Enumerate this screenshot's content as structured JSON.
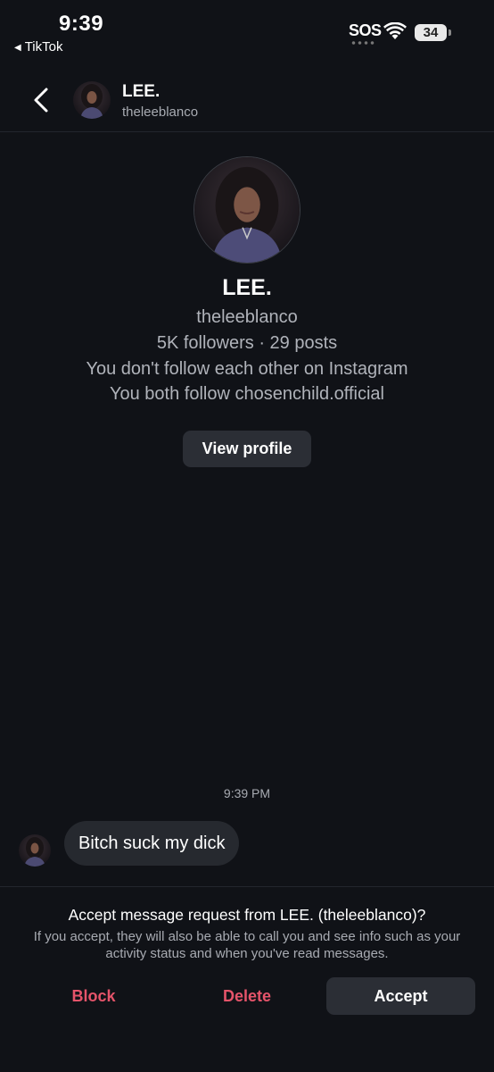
{
  "status_bar": {
    "time": "9:39",
    "back_app": "TikTok",
    "sos": "SOS",
    "battery": "34"
  },
  "header": {
    "name": "LEE.",
    "username": "theleeblanco"
  },
  "profile": {
    "name": "LEE.",
    "username": "theleeblanco",
    "stats": "5K followers · 29 posts",
    "follow_status": "You don't follow each other on Instagram",
    "mutual": "You both follow chosenchild.official",
    "view_profile_label": "View profile"
  },
  "messages": [
    {
      "time": "9:39 PM",
      "text": "Bitch suck my dick"
    }
  ],
  "request": {
    "title": "Accept message request from LEE. (theleeblanco)?",
    "description": "If you accept, they will also be able to call you and see info such as your activity status and when you've read messages.",
    "block_label": "Block",
    "delete_label": "Delete",
    "accept_label": "Accept"
  },
  "colors": {
    "background": "#101217",
    "secondary_text": "#a8abb2",
    "danger": "#e5546a",
    "button_bg": "#2b2e35",
    "bubble_bg": "#26292f"
  }
}
